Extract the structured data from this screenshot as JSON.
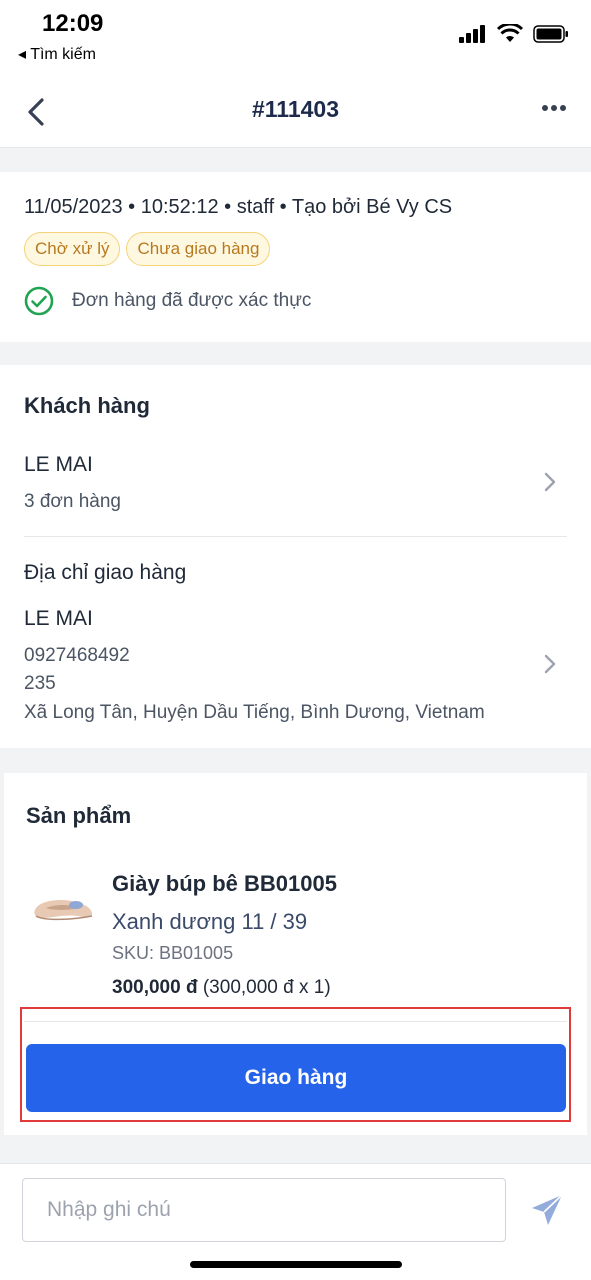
{
  "status": {
    "time": "12:09",
    "back_app": "◂ Tìm kiếm"
  },
  "nav": {
    "title": "#111403"
  },
  "order": {
    "meta": "11/05/2023 • 10:52:12 • staff • Tạo bởi Bé Vy CS",
    "badges": [
      "Chờ xử lý",
      "Chưa giao hàng"
    ],
    "verified_text": "Đơn hàng đã được xác thực"
  },
  "customer": {
    "section_title": "Khách hàng",
    "name": "LE MAI",
    "orders_count": "3 đơn hàng"
  },
  "address": {
    "section_title": "Địa chỉ giao hàng",
    "name": "LE MAI",
    "phone": "0927468492",
    "street": "235",
    "region": "Xã Long Tân, Huyện Dầu Tiếng, Bình Dương, Vietnam"
  },
  "products": {
    "section_title": "Sản phẩm",
    "item": {
      "name": "Giày búp bê BB01005",
      "variant": "Xanh dương 11 / 39",
      "sku": "SKU: BB01005",
      "price": "300,000 đ",
      "price_detail": " (300,000 đ x 1)"
    },
    "ship_button": "Giao hàng"
  },
  "note": {
    "placeholder": "Nhập ghi chú"
  },
  "colors": {
    "primary": "#2563eb",
    "badge_text": "#b7791f",
    "verified": "#22a352",
    "highlight": "#e03a3a"
  }
}
